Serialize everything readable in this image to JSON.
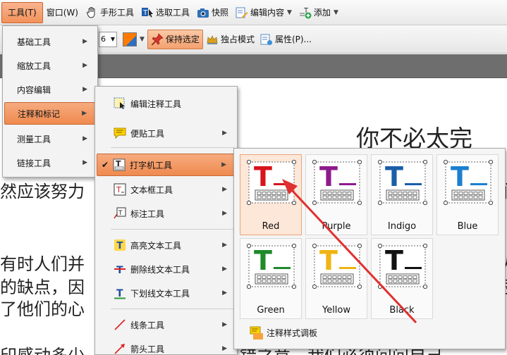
{
  "menubar": {
    "tools": "工具(T)",
    "window": "窗口(W)",
    "hand_tool": "手形工具",
    "select_tool": "选取工具",
    "snapshot": "快照",
    "edit_content": "编辑内容",
    "add": "添加"
  },
  "toolbar2": {
    "zoom_value": "6",
    "keep_selected": "保持选定",
    "exclusive_mode": "独占模式",
    "properties": "属性(P)..."
  },
  "tools_menu": {
    "items": [
      "基础工具",
      "缩放工具",
      "内容编辑",
      "注释和标记",
      "测量工具",
      "链接工具"
    ]
  },
  "annotation_menu": {
    "items": [
      "编辑注释工具",
      "便贴工具",
      "打字机工具",
      "文本框工具",
      "标注工具",
      "高亮文本工具",
      "删除线文本工具",
      "下划线文本工具",
      "线条工具",
      "箭头工具"
    ]
  },
  "typewriter_styles": {
    "swatches": [
      {
        "label": "Red",
        "color": "#d8141c"
      },
      {
        "label": "Purple",
        "color": "#8e1a8e"
      },
      {
        "label": "Indigo",
        "color": "#1a5ea8"
      },
      {
        "label": "Blue",
        "color": "#1c7fcf"
      },
      {
        "label": "Green",
        "color": "#1e8a2a"
      },
      {
        "label": "Yellow",
        "color": "#f0b313"
      },
      {
        "label": "Black",
        "color": "#111111"
      }
    ],
    "palette_label": "注释样式调板"
  },
  "document": {
    "heading_fragment": "你不必太完",
    "line1": "然应该努力",
    "line1_right": "们",
    "line2": "有时人们并",
    "line2_right": "人",
    "line3": "的缺点，因",
    "line3_right": "忌",
    "line4": "了他们的心",
    "line5_left": "印感动多少",
    "line5_right": "错之意，我们必须问问自己"
  },
  "colors": {
    "accent": "#f3925b",
    "arrow": "#e03030"
  }
}
